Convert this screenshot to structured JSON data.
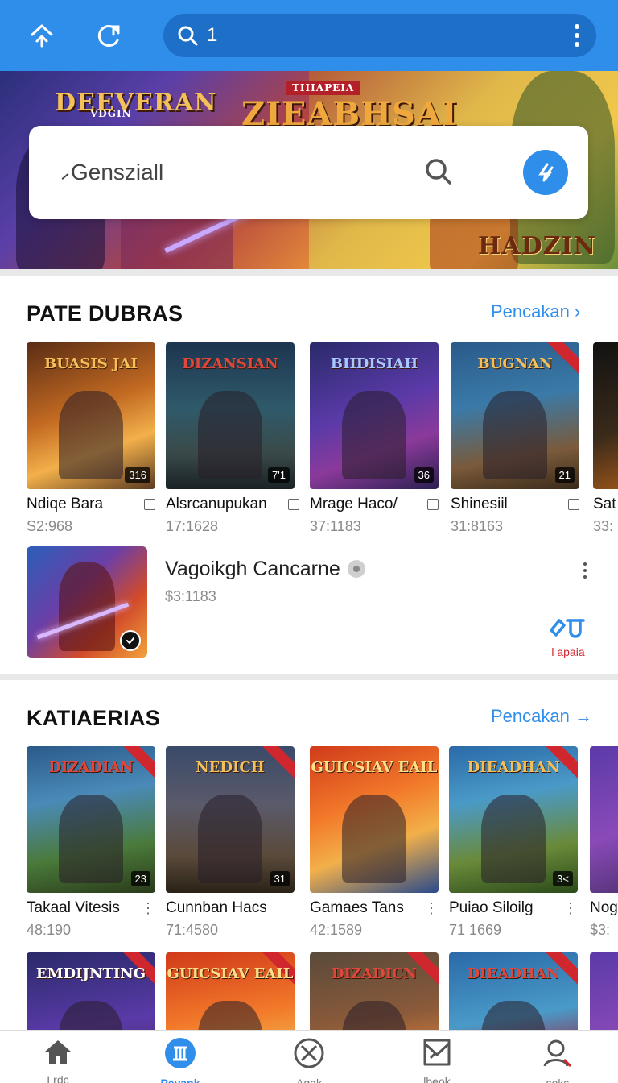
{
  "topbar": {
    "search_query": "1"
  },
  "banner": {
    "left_title": "DEEVERAN",
    "left_subtitle": "VDGIN",
    "center_tag": "TIIIAPEIA",
    "center_title": "ZIEABHSAI",
    "right_title": "HADZIN"
  },
  "search": {
    "value": "Gensziall"
  },
  "section1": {
    "title": "PATE DUBRAS",
    "link": "Pencakan",
    "cards": [
      {
        "name": "Ndiqe Bara",
        "meta": "S2:968",
        "badge": "316",
        "art": "BUASIS JAI"
      },
      {
        "name": "Alsrcanupukan",
        "meta": "17:1628",
        "badge": "7'1",
        "art": "DIZANSIAN"
      },
      {
        "name": "Mrage Haco/",
        "meta": "37:1183",
        "badge": "36",
        "art": "BIIDISIAH"
      },
      {
        "name": "Shinesiil",
        "meta": "31:8163",
        "badge": "21",
        "art": "BUGNAN"
      },
      {
        "name": "Sat",
        "meta": "33:",
        "badge": "",
        "art": ""
      }
    ],
    "featured": {
      "title": "Vagoikgh Cancarne",
      "meta": "$3:1183",
      "action_label": "l apaia"
    }
  },
  "section2": {
    "title": "KATIAERIAS",
    "link": "Pencakan",
    "cards": [
      {
        "name": "Takaal Vitesis",
        "meta": "48:190",
        "badge": "23",
        "art": "DIZADIAN"
      },
      {
        "name": "Cunnban Hacs",
        "meta": "71:4580",
        "badge": "31",
        "art": "NEDICH"
      },
      {
        "name": "Gamaes Tans",
        "meta": "42:1589",
        "badge": "",
        "art": "GUICSIAV EAIL"
      },
      {
        "name": "Puiao Siloilg",
        "meta": "71 1669",
        "badge": "3<",
        "art": "DIEADHAN"
      },
      {
        "name": "Nog",
        "meta": "$3:",
        "badge": "",
        "art": ""
      }
    ],
    "row2_art": [
      "EMDIJNTING",
      "GUICSIAV EAIL",
      "DIZADICN",
      "DIEADHAN"
    ]
  },
  "bottom_nav": [
    {
      "label": "Lrdc",
      "icon": "home-icon"
    },
    {
      "label": "Pevank",
      "icon": "library-icon"
    },
    {
      "label": "Agak",
      "icon": "close-circle-icon"
    },
    {
      "label": "lbeok",
      "icon": "mail-icon"
    },
    {
      "label": "soks",
      "icon": "profile-icon"
    }
  ],
  "colors": {
    "primary": "#2f8eea",
    "topbar": "#2f8eea",
    "accent_red": "#d0272f"
  }
}
